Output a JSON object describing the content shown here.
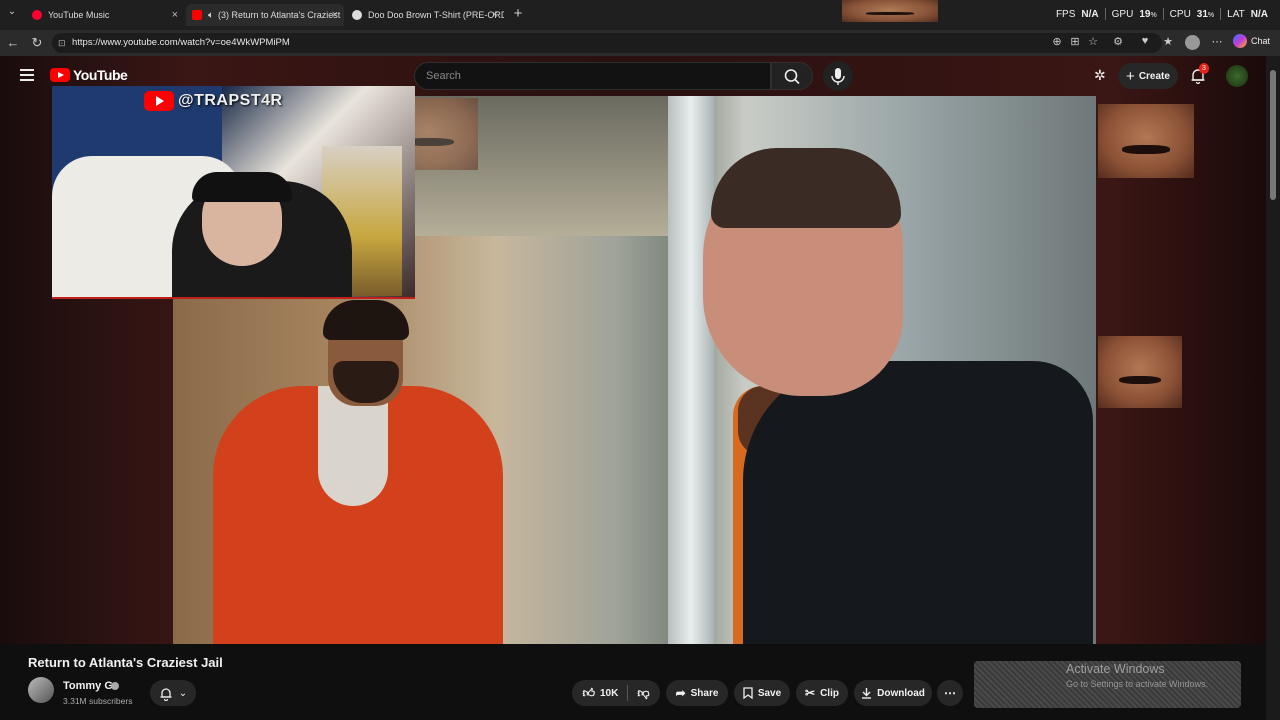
{
  "browser": {
    "tabs": [
      {
        "label": "YouTube Music",
        "active": false
      },
      {
        "label": "(3) Return to Atlanta's Craziest",
        "active": true
      },
      {
        "label": "Doo Doo Brown T-Shirt (PRE-ORD",
        "active": false
      }
    ],
    "new_tab_label": "+",
    "url": "https://www.youtube.com/watch?v=oe4WkWPMiPM",
    "copilot_label": "Chat",
    "perf": {
      "fps_label": "FPS",
      "fps_value": "N/A",
      "gpu_label": "GPU",
      "gpu_value": "19",
      "cpu_label": "CPU",
      "cpu_value": "31",
      "lat_label": "LAT",
      "lat_value": "N/A",
      "unit": "%"
    }
  },
  "youtube": {
    "logo_text": "YouTube",
    "search_placeholder": "Search",
    "create_label": "Create",
    "notification_count": "3"
  },
  "video": {
    "overlay_channel": "@TRAPST4R",
    "title": "Return to Atlanta's Craziest Jail",
    "channel_name": "Tommy G",
    "subscribers": "3.31M subscribers",
    "likes": "10K",
    "share_label": "Share",
    "save_label": "Save",
    "clip_label": "Clip",
    "download_label": "Download"
  },
  "watermark": {
    "line1": "Activate Windows",
    "line2": "Go to Settings to activate Windows."
  },
  "colors": {
    "youtube_red": "#ff0000",
    "background": "#0f0f0f",
    "pill_bg": "#272727"
  }
}
